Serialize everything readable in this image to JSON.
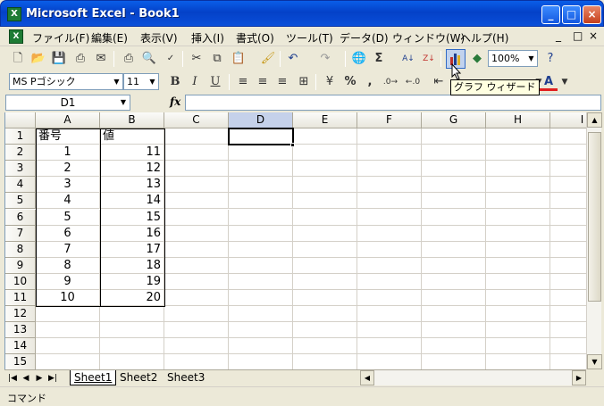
{
  "window": {
    "title": "Microsoft Excel - Book1"
  },
  "menu": {
    "items": [
      "ファイル(F)",
      "編集(E)",
      "表示(V)",
      "挿入(I)",
      "書式(O)",
      "ツール(T)",
      "データ(D)",
      "ウィンドウ(W)",
      "ヘルプ(H)"
    ],
    "doc_controls": [
      "_",
      "□",
      "×"
    ]
  },
  "toolbar_standard": {
    "zoom": "100%"
  },
  "toolbar_format": {
    "font": "MS Pゴシック",
    "size": "11",
    "bold": "B",
    "italic": "I",
    "underline": "U",
    "percent": "%",
    "comma": ","
  },
  "tooltip": "グラフ ウィザード",
  "formula_bar": {
    "name_box": "D1",
    "fx_label": "fx",
    "value": ""
  },
  "grid": {
    "columns": [
      "A",
      "B",
      "C",
      "D",
      "E",
      "F",
      "G",
      "H",
      "I"
    ],
    "active_column": "D",
    "rows": [
      "1",
      "2",
      "3",
      "4",
      "5",
      "6",
      "7",
      "8",
      "9",
      "10",
      "11",
      "12",
      "13",
      "14",
      "15"
    ],
    "header_a": "番号",
    "header_b": "値",
    "data": [
      {
        "a": "1",
        "b": "11"
      },
      {
        "a": "2",
        "b": "12"
      },
      {
        "a": "3",
        "b": "13"
      },
      {
        "a": "4",
        "b": "14"
      },
      {
        "a": "5",
        "b": "15"
      },
      {
        "a": "6",
        "b": "16"
      },
      {
        "a": "7",
        "b": "17"
      },
      {
        "a": "8",
        "b": "18"
      },
      {
        "a": "9",
        "b": "19"
      },
      {
        "a": "10",
        "b": "20"
      }
    ]
  },
  "sheets": [
    "Sheet1",
    "Sheet2",
    "Sheet3"
  ],
  "status": "コマンド"
}
